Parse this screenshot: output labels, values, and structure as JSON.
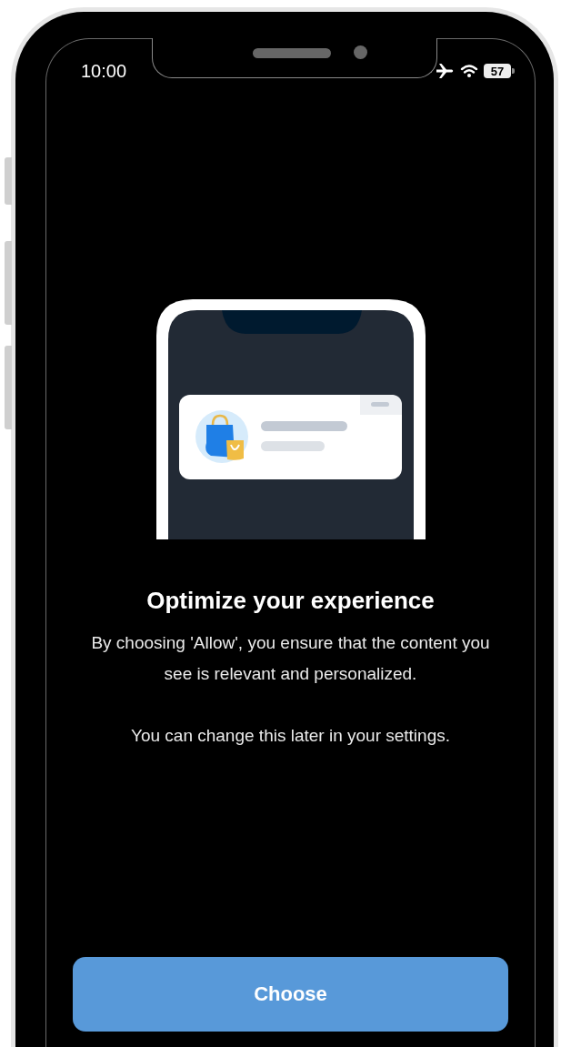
{
  "status_bar": {
    "time": "10:00",
    "battery": "57"
  },
  "title": "Optimize your experience",
  "paragraphs": [
    "By choosing 'Allow', you ensure that the content you see is relevant and personalized.",
    "You can change this later in your settings."
  ],
  "button": {
    "label": "Choose"
  }
}
